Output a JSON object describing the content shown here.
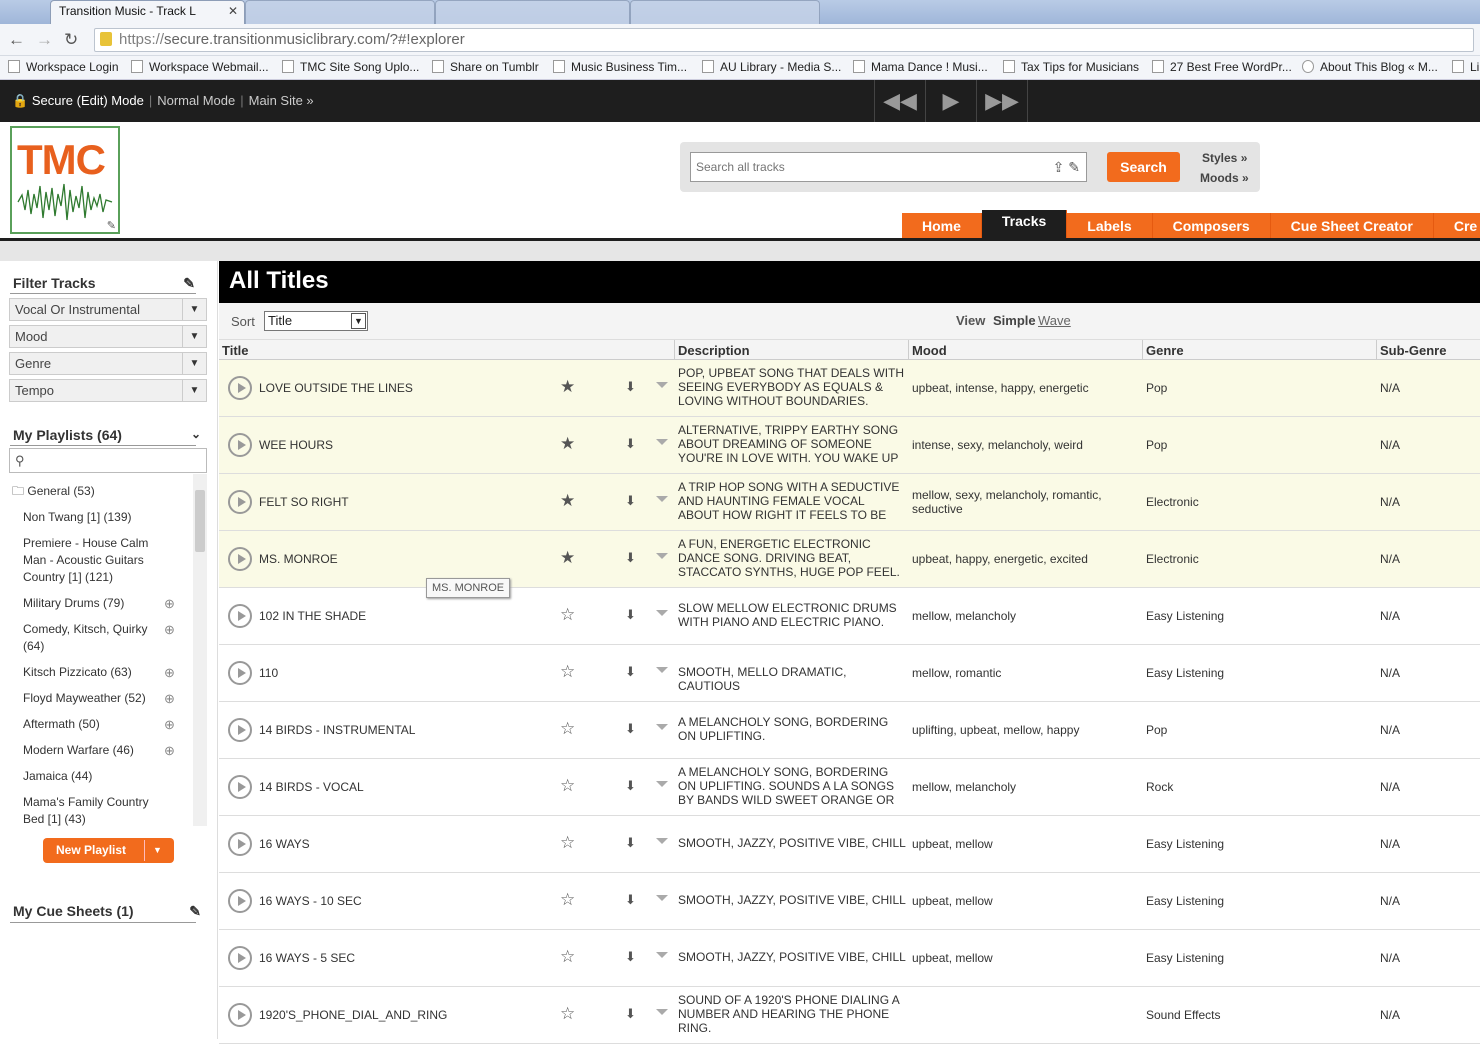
{
  "browser": {
    "tab_title": "Transition Music - Track L",
    "url_scheme": "https://",
    "url_rest": "secure.transitionmusiclibrary.com/?#!explorer",
    "bookmarks": [
      "Workspace Login",
      "Workspace Webmail...",
      "TMC Site Song Uplo...",
      "Share on Tumblr",
      "Music Business Tim...",
      "AU Library - Media S...",
      "Mama Dance ! Musi...",
      "Tax Tips for Musicians",
      "27 Best Free WordPr...",
      "About This Blog « M...",
      "Li"
    ]
  },
  "topbar": {
    "secure_mode": "Secure (Edit) Mode",
    "normal_mode": "Normal Mode",
    "main_site": "Main Site »"
  },
  "logo": {
    "text": "TMC"
  },
  "search": {
    "placeholder": "Search all tracks",
    "button": "Search",
    "styles": "Styles »",
    "moods": "Moods »"
  },
  "nav": [
    "Home",
    "Tracks",
    "Labels",
    "Composers",
    "Cue Sheet Creator",
    "Cre"
  ],
  "sidebar": {
    "filter_title": "Filter Tracks",
    "filters": [
      "Vocal Or Instrumental",
      "Mood",
      "Genre",
      "Tempo"
    ],
    "playlists_title": "My Playlists (64)",
    "playlists": [
      {
        "name": "General (53)"
      },
      {
        "name": "Non Twang [1] (139)"
      },
      {
        "name": "Premiere - House Calm Man - Acoustic Guitars Country [1] (121)"
      },
      {
        "name": "Military Drums (79)"
      },
      {
        "name": "Comedy, Kitsch, Quirky (64)"
      },
      {
        "name": "Kitsch Pizzicato (63)"
      },
      {
        "name": "Floyd Mayweather (52)"
      },
      {
        "name": "Aftermath (50)"
      },
      {
        "name": "Modern Warfare (46)"
      },
      {
        "name": "Jamaica (44)"
      },
      {
        "name": "Mama's Family Country Bed [1] (43)"
      }
    ],
    "new_playlist": "New Playlist",
    "cue_title": "My Cue Sheets (1)"
  },
  "main": {
    "title": "All Titles",
    "sort_label": "Sort",
    "sort_value": "Title",
    "view_label": "View",
    "view_simple": "Simple",
    "view_wave": "Wave",
    "columns": [
      "Title",
      "Description",
      "Mood",
      "Genre",
      "Sub-Genre"
    ],
    "tooltip": "MS. MONROE",
    "tracks": [
      {
        "title": "LOVE OUTSIDE THE LINES",
        "desc": "POP, UPBEAT SONG THAT DEALS WITH SEEING EVERYBODY AS EQUALS & LOVING WITHOUT BOUNDARIES.",
        "mood": "upbeat, intense, happy, energetic",
        "genre": "Pop",
        "sub": "N/A",
        "fav": true
      },
      {
        "title": "WEE HOURS",
        "desc": "ALTERNATIVE, TRIPPY EARTHY SONG ABOUT DREAMING OF SOMEONE YOU'RE IN LOVE WITH. YOU WAKE UP &",
        "mood": "intense, sexy, melancholy, weird",
        "genre": "Pop",
        "sub": "N/A",
        "fav": true
      },
      {
        "title": "FELT SO RIGHT",
        "desc": "A TRIP HOP SONG WITH A SEDUCTIVE AND HAUNTING FEMALE VOCAL ABOUT HOW RIGHT IT FEELS TO BE WITH HER. A",
        "mood": "mellow, sexy, melancholy, romantic, seductive",
        "genre": "Electronic",
        "sub": "N/A",
        "fav": true
      },
      {
        "title": "MS. MONROE",
        "desc": "A FUN, ENERGETIC ELECTRONIC DANCE SONG. DRIVING BEAT, STACCATO SYNTHS, HUGE POP FEEL. TYPICAL",
        "mood": "upbeat, happy, energetic, excited",
        "genre": "Electronic",
        "sub": "N/A",
        "fav": true
      },
      {
        "title": "102 IN THE SHADE",
        "desc": "SLOW MELLOW ELECTRONIC DRUMS WITH PIANO AND ELECTRIC PIANO.",
        "mood": "mellow, melancholy",
        "genre": "Easy Listening",
        "sub": "N/A",
        "fav": false
      },
      {
        "title": "110",
        "desc": "SMOOTH, MELLO DRAMATIC, CAUTIOUS",
        "mood": "mellow, romantic",
        "genre": "Easy Listening",
        "sub": "N/A",
        "fav": false
      },
      {
        "title": "14 BIRDS - INSTRUMENTAL",
        "desc": "A MELANCHOLY SONG, BORDERING ON UPLIFTING.",
        "mood": "uplifting, upbeat, mellow, happy",
        "genre": "Pop",
        "sub": "N/A",
        "fav": false
      },
      {
        "title": "14 BIRDS - VOCAL",
        "desc": "A MELANCHOLY SONG, BORDERING ON UPLIFTING. SOUNDS A LA SONGS BY BANDS WILD SWEET ORANGE OR THE",
        "mood": "mellow, melancholy",
        "genre": "Rock",
        "sub": "N/A",
        "fav": false
      },
      {
        "title": "16 WAYS",
        "desc": "SMOOTH, JAZZY, POSITIVE VIBE, CHILL",
        "mood": "upbeat, mellow",
        "genre": "Easy Listening",
        "sub": "N/A",
        "fav": false
      },
      {
        "title": "16 WAYS - 10 SEC",
        "desc": "SMOOTH, JAZZY, POSITIVE VIBE, CHILL",
        "mood": "upbeat, mellow",
        "genre": "Easy Listening",
        "sub": "N/A",
        "fav": false
      },
      {
        "title": "16 WAYS - 5 SEC",
        "desc": "SMOOTH, JAZZY, POSITIVE VIBE, CHILL",
        "mood": "upbeat, mellow",
        "genre": "Easy Listening",
        "sub": "N/A",
        "fav": false
      },
      {
        "title": "1920'S_PHONE_DIAL_AND_RING",
        "desc": "SOUND OF A 1920'S PHONE DIALING A NUMBER AND HEARING THE PHONE RING.",
        "mood": "",
        "genre": "Sound Effects",
        "sub": "N/A",
        "fav": false
      }
    ]
  }
}
